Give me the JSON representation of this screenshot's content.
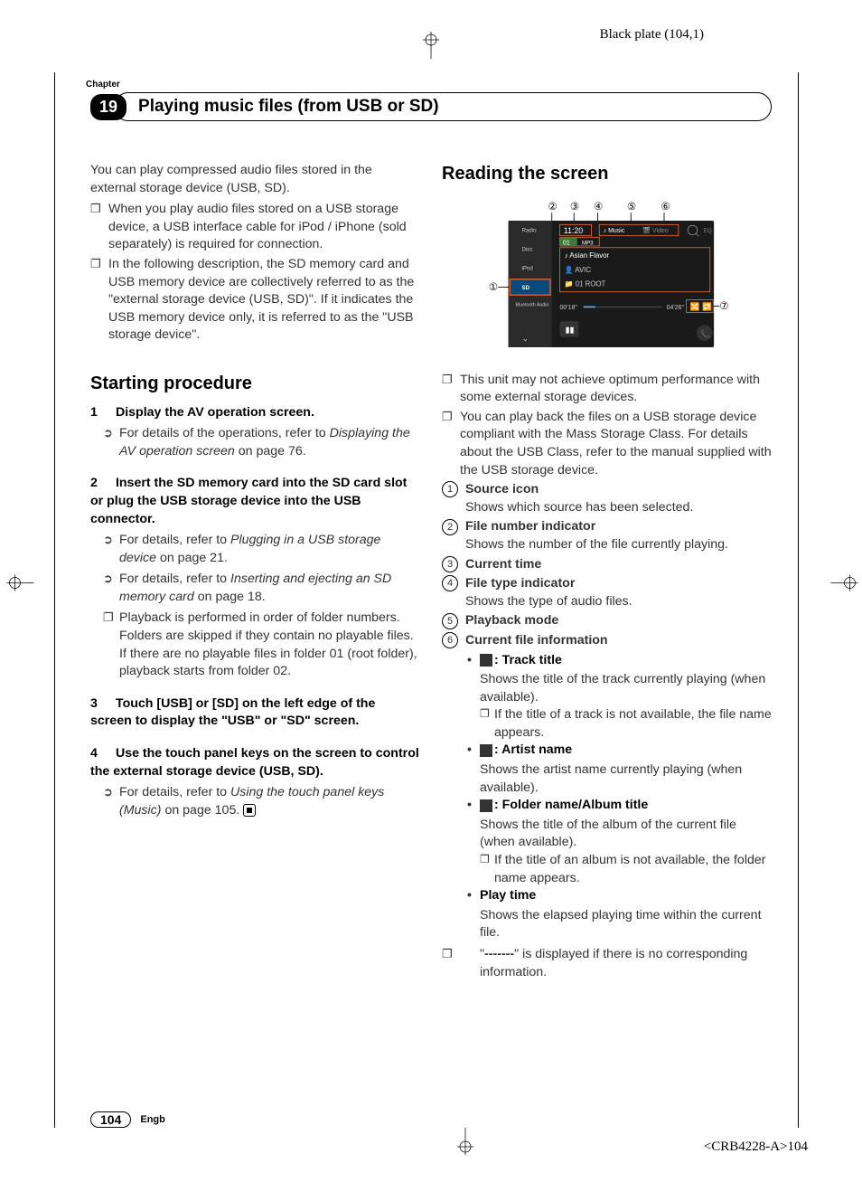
{
  "plate_label": "Black plate (104,1)",
  "chapter_label": "Chapter",
  "chapter_number": "19",
  "chapter_title": "Playing music files (from USB or SD)",
  "left_col": {
    "intro": "You can play compressed audio files stored in the external storage device (USB, SD).",
    "bullets": [
      "When you play audio files stored on a USB storage device, a USB interface cable for iPod / iPhone (sold separately) is required for connection.",
      "In the following description, the SD memory card and USB memory device are collectively referred to as the \"external storage device (USB, SD)\". If it indicates the USB memory device only, it is referred to as the \"USB storage device\"."
    ],
    "h2": "Starting procedure",
    "step1_num": "1",
    "step1_title": "Display the AV operation screen.",
    "step1_sub_prefix": "For details of the operations, refer to ",
    "step1_sub_italic": "Displaying the AV operation screen",
    "step1_sub_suffix": " on page 76.",
    "step2_num": "2",
    "step2_title": "Insert the SD memory card into the SD card slot or plug the USB storage device into the USB connector.",
    "step2_sub1_prefix": "For details, refer to ",
    "step2_sub1_italic": "Plugging in a USB storage device",
    "step2_sub1_suffix": " on page 21.",
    "step2_sub2_prefix": "For details, refer to ",
    "step2_sub2_italic": "Inserting and ejecting an SD memory card",
    "step2_sub2_suffix": " on page 18.",
    "step2_sub3": "Playback is performed in order of folder numbers. Folders are skipped if they contain no playable files. If there are no playable files in folder 01 (root folder), playback starts from folder 02.",
    "step3_num": "3",
    "step3_title": "Touch [USB] or [SD] on the left edge of the screen to display the \"USB\" or \"SD\" screen.",
    "step4_num": "4",
    "step4_title": "Use the touch panel keys on the screen to control the external storage device (USB, SD).",
    "step4_sub_prefix": "For details, refer to ",
    "step4_sub_italic": "Using the touch panel keys (Music)",
    "step4_sub_suffix": " on page 105."
  },
  "right_col": {
    "h2": "Reading the screen",
    "figure": {
      "callout_labels": [
        "①",
        "②",
        "③",
        "④",
        "⑤",
        "⑥",
        "⑦"
      ],
      "time": "11:20",
      "tab_music": "♪ Music",
      "tab_video": "🎬 Video",
      "file_num": "01",
      "file_type": "MP3",
      "track": "♪ Asian Flavor",
      "artist": "👤 AVIC",
      "folder": "📁 01 ROOT",
      "elapsed": "00'18\"",
      "total": "04'26\"",
      "sidebar": [
        "Radio",
        "Disc",
        "iPod",
        "SD",
        "Bluetooth Audio"
      ]
    },
    "bullets": [
      "This unit may not achieve optimum performance with some external storage devices.",
      "You can play back the files on a USB storage device compliant with the Mass Storage Class. For details about the USB Class, refer to the manual supplied with the USB storage device."
    ],
    "callouts": [
      {
        "num": "1",
        "label": "Source icon",
        "desc": "Shows which source has been selected."
      },
      {
        "num": "2",
        "label": "File number indicator",
        "desc": "Shows the number of the file currently playing."
      },
      {
        "num": "3",
        "label": "Current time",
        "desc": ""
      },
      {
        "num": "4",
        "label": "File type indicator",
        "desc": "Shows the type of audio files."
      },
      {
        "num": "5",
        "label": "Playback mode",
        "desc": ""
      },
      {
        "num": "6",
        "label": "Current file information",
        "desc": ""
      }
    ],
    "file_info": {
      "track_label": ": Track title",
      "track_desc": "Shows the title of the track currently playing (when available).",
      "track_sub": "If the title of a track is not available, the file name appears.",
      "artist_label": ": Artist name",
      "artist_desc": "Shows the artist name currently playing (when available).",
      "folder_label": ": Folder name/Album title",
      "folder_desc": "Shows the title of the album of the current file (when available).",
      "folder_sub": "If the title of an album is not available, the folder name appears.",
      "playtime_label": "Play time",
      "playtime_desc": "Shows the elapsed playing time within the current file."
    },
    "dash_note_prefix": "\"",
    "dash_note_mid": "-------",
    "dash_note_suffix": "\" is displayed if there is no corresponding information."
  },
  "footer": {
    "page_num": "104",
    "lang": "Engb",
    "code": "<CRB4228-A>104"
  }
}
